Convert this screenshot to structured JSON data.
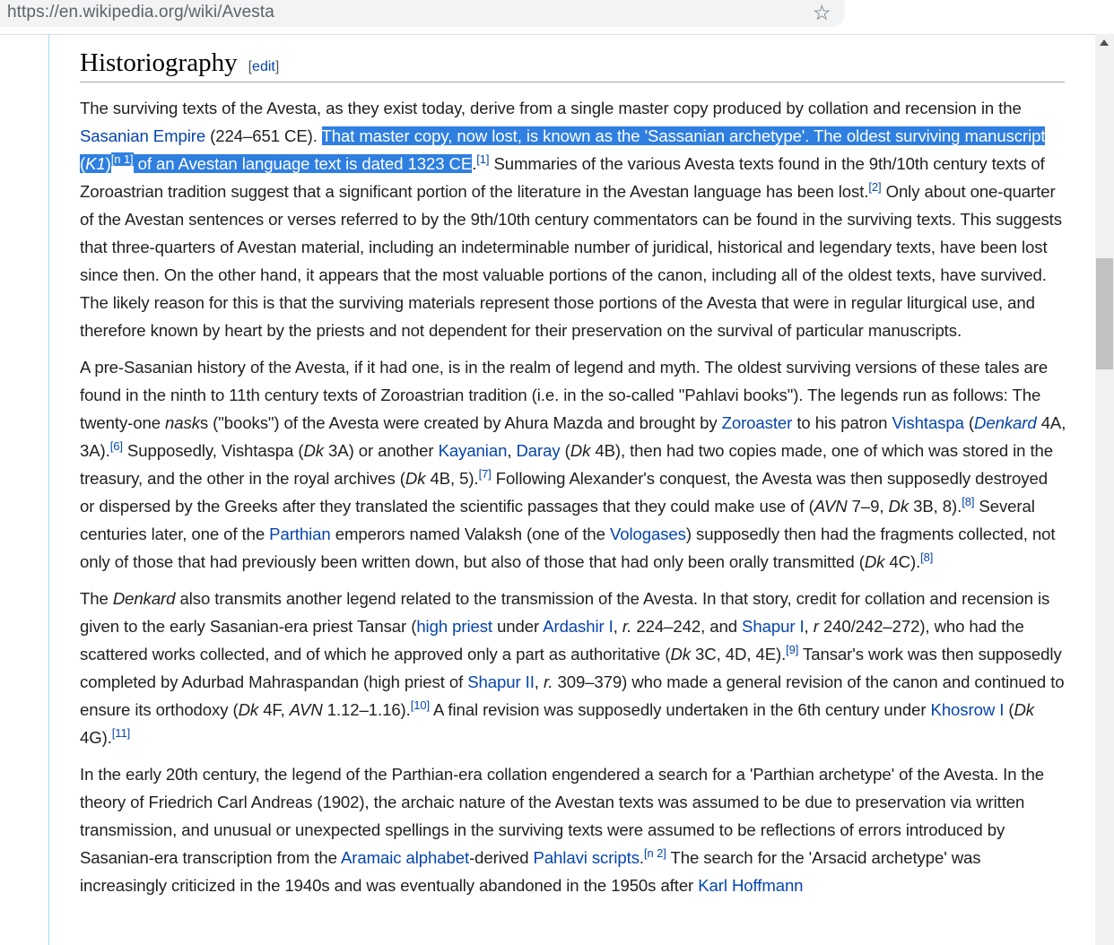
{
  "browser": {
    "url": "https://en.wikipedia.org/wiki/Avesta",
    "bookmark_icon": "star-icon"
  },
  "article": {
    "heading": "Historiography",
    "edit_open": "[",
    "edit_link": "edit",
    "edit_close": "]",
    "p1": [
      {
        "t": "The surviving texts of the Avesta, as they exist today, derive from a single master copy produced by collation and recension in the "
      },
      {
        "t": "Sasanian Empire",
        "link": true
      },
      {
        "t": " (224–651 CE). "
      },
      {
        "t": "That master copy, now lost, is known as the 'Sassanian archetype'. The oldest surviving manuscript (",
        "hl": true
      },
      {
        "t": "K1",
        "hl": true,
        "i": true
      },
      {
        "t": ")",
        "hl": true
      },
      {
        "t": "[n 1]",
        "hl": true,
        "sup": true
      },
      {
        "t": " of an Avestan language text is dated 1323 CE",
        "hl": true
      },
      {
        "t": "."
      },
      {
        "t": "[1]",
        "sup": true
      },
      {
        "t": " Summaries of the various Avesta texts found in the 9th/10th century texts of Zoroastrian tradition suggest that a significant portion of the literature in the Avestan language has been lost."
      },
      {
        "t": "[2]",
        "sup": true
      },
      {
        "t": " Only about one-quarter of the Avestan sentences or verses referred to by the 9th/10th century commentators can be found in the surviving texts. This suggests that three-quarters of Avestan material, including an indeterminable number of juridical, historical and legendary texts, have been lost since then. On the other hand, it appears that the most valuable portions of the canon, including all of the oldest texts, have survived. The likely reason for this is that the surviving materials represent those portions of the Avesta that were in regular liturgical use, and therefore known by heart by the priests and not dependent for their preservation on the survival of particular manuscripts."
      }
    ],
    "p2": [
      {
        "t": "A pre-Sasanian history of the Avesta, if it had one, is in the realm of legend and myth. The oldest surviving versions of these tales are found in the ninth to 11th century texts of Zoroastrian tradition (i.e. in the so-called \"Pahlavi books\"). The legends run as follows: The twenty-one "
      },
      {
        "t": "nask",
        "i": true
      },
      {
        "t": "s (\"books\") of the Avesta were created by Ahura Mazda and brought by "
      },
      {
        "t": "Zoroaster",
        "link": true
      },
      {
        "t": " to his patron "
      },
      {
        "t": "Vishtaspa",
        "link": true
      },
      {
        "t": " ("
      },
      {
        "t": "Denkard",
        "link": true,
        "i": true
      },
      {
        "t": " 4A, 3A)."
      },
      {
        "t": "[6]",
        "sup": true
      },
      {
        "t": " Supposedly, Vishtaspa ("
      },
      {
        "t": "Dk",
        "i": true
      },
      {
        "t": " 3A) or another "
      },
      {
        "t": "Kayanian",
        "link": true
      },
      {
        "t": ", "
      },
      {
        "t": "Daray",
        "link": true
      },
      {
        "t": " ("
      },
      {
        "t": "Dk",
        "i": true
      },
      {
        "t": " 4B), then had two copies made, one of which was stored in the treasury, and the other in the royal archives ("
      },
      {
        "t": "Dk",
        "i": true
      },
      {
        "t": " 4B, 5)."
      },
      {
        "t": "[7]",
        "sup": true
      },
      {
        "t": " Following Alexander's conquest, the Avesta was then supposedly destroyed or dispersed by the Greeks after they translated the scientific passages that they could make use of ("
      },
      {
        "t": "AVN",
        "i": true
      },
      {
        "t": " 7–9, "
      },
      {
        "t": "Dk",
        "i": true
      },
      {
        "t": " 3B, 8)."
      },
      {
        "t": "[8]",
        "sup": true
      },
      {
        "t": " Several centuries later, one of the "
      },
      {
        "t": "Parthian",
        "link": true
      },
      {
        "t": " emperors named Valaksh (one of the "
      },
      {
        "t": "Vologases",
        "link": true
      },
      {
        "t": ") supposedly then had the fragments collected, not only of those that had previously been written down, but also of those that had only been orally transmitted ("
      },
      {
        "t": "Dk",
        "i": true
      },
      {
        "t": " 4C)."
      },
      {
        "t": "[8]",
        "sup": true
      }
    ],
    "p3": [
      {
        "t": "The "
      },
      {
        "t": "Denkard",
        "i": true
      },
      {
        "t": " also transmits another legend related to the transmission of the Avesta. In that story, credit for collation and recension is given to the early Sasanian-era priest Tansar ("
      },
      {
        "t": "high priest",
        "link": true
      },
      {
        "t": " under "
      },
      {
        "t": "Ardashir I",
        "link": true
      },
      {
        "t": ", "
      },
      {
        "t": "r.",
        "i": true
      },
      {
        "t": " 224–242, and "
      },
      {
        "t": "Shapur I",
        "link": true
      },
      {
        "t": ", "
      },
      {
        "t": "r",
        "i": true
      },
      {
        "t": " 240/242–272), who had the scattered works collected, and of which he approved only a part as authoritative ("
      },
      {
        "t": "Dk",
        "i": true
      },
      {
        "t": " 3C, 4D, 4E)."
      },
      {
        "t": "[9]",
        "sup": true
      },
      {
        "t": " Tansar's work was then supposedly completed by Adurbad Mahraspandan (high priest of "
      },
      {
        "t": "Shapur II",
        "link": true
      },
      {
        "t": ", "
      },
      {
        "t": "r.",
        "i": true
      },
      {
        "t": " 309–379) who made a general revision of the canon and continued to ensure its orthodoxy ("
      },
      {
        "t": "Dk",
        "i": true
      },
      {
        "t": " 4F, "
      },
      {
        "t": "AVN",
        "i": true
      },
      {
        "t": " 1.12–1.16)."
      },
      {
        "t": "[10]",
        "sup": true
      },
      {
        "t": " A final revision was supposedly undertaken in the 6th century under "
      },
      {
        "t": "Khosrow I",
        "link": true
      },
      {
        "t": " ("
      },
      {
        "t": "Dk",
        "i": true
      },
      {
        "t": " 4G)."
      },
      {
        "t": "[11]",
        "sup": true
      }
    ],
    "p4": [
      {
        "t": "In the early 20th century, the legend of the Parthian-era collation engendered a search for a 'Parthian archetype' of the Avesta. In the theory of Friedrich Carl Andreas (1902), the archaic nature of the Avestan texts was assumed to be due to preservation via written transmission, and unusual or unexpected spellings in the surviving texts were assumed to be reflections of errors introduced by Sasanian-era transcription from the "
      },
      {
        "t": "Aramaic alphabet",
        "link": true
      },
      {
        "t": "-derived "
      },
      {
        "t": "Pahlavi scripts",
        "link": true
      },
      {
        "t": "."
      },
      {
        "t": "[n 2]",
        "sup": true
      },
      {
        "t": " The search for the 'Arsacid archetype' was increasingly criticized in the 1940s and was eventually abandoned in the 1950s after "
      },
      {
        "t": "Karl Hoffmann",
        "link": true
      }
    ]
  }
}
